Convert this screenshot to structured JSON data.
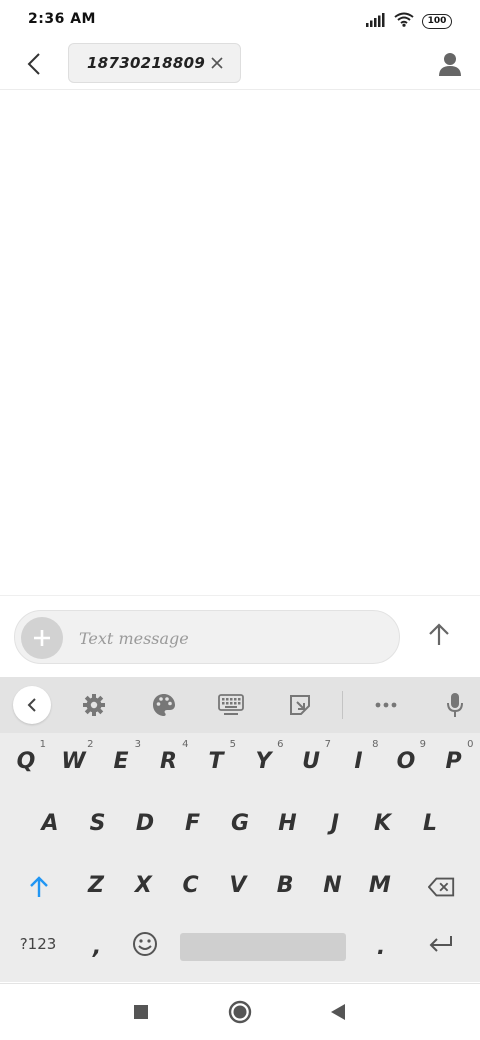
{
  "status_bar": {
    "time": "2:36 AM",
    "battery": "100",
    "icons": [
      "signal-icon",
      "wifi-icon",
      "battery-icon"
    ]
  },
  "header": {
    "back_icon": "chevron-left-icon",
    "recipient": "18730218809",
    "remove_icon": "close-icon",
    "contact_icon": "person-icon"
  },
  "compose": {
    "attach_icon": "plus-icon",
    "placeholder": "Text message",
    "send_icon": "arrow-up-icon"
  },
  "keyboard": {
    "toolbar": [
      "chevron-left-icon",
      "gear-icon",
      "palette-icon",
      "keyboard-icon",
      "clipboard-icon",
      "more-icon",
      "microphone-icon"
    ],
    "row1": [
      {
        "key": "Q",
        "hint": "1"
      },
      {
        "key": "W",
        "hint": "2"
      },
      {
        "key": "E",
        "hint": "3"
      },
      {
        "key": "R",
        "hint": "4"
      },
      {
        "key": "T",
        "hint": "5"
      },
      {
        "key": "Y",
        "hint": "6"
      },
      {
        "key": "U",
        "hint": "7"
      },
      {
        "key": "I",
        "hint": "8"
      },
      {
        "key": "O",
        "hint": "9"
      },
      {
        "key": "P",
        "hint": "0"
      }
    ],
    "row2": [
      "A",
      "S",
      "D",
      "F",
      "G",
      "H",
      "J",
      "K",
      "L"
    ],
    "row3": [
      "Z",
      "X",
      "C",
      "V",
      "B",
      "N",
      "M"
    ],
    "symbols_label": "?123",
    "comma": ",",
    "period": ".",
    "shift_color": "#2196F3"
  },
  "navbar": [
    "square-icon",
    "circle-icon",
    "back-triangle-icon"
  ]
}
